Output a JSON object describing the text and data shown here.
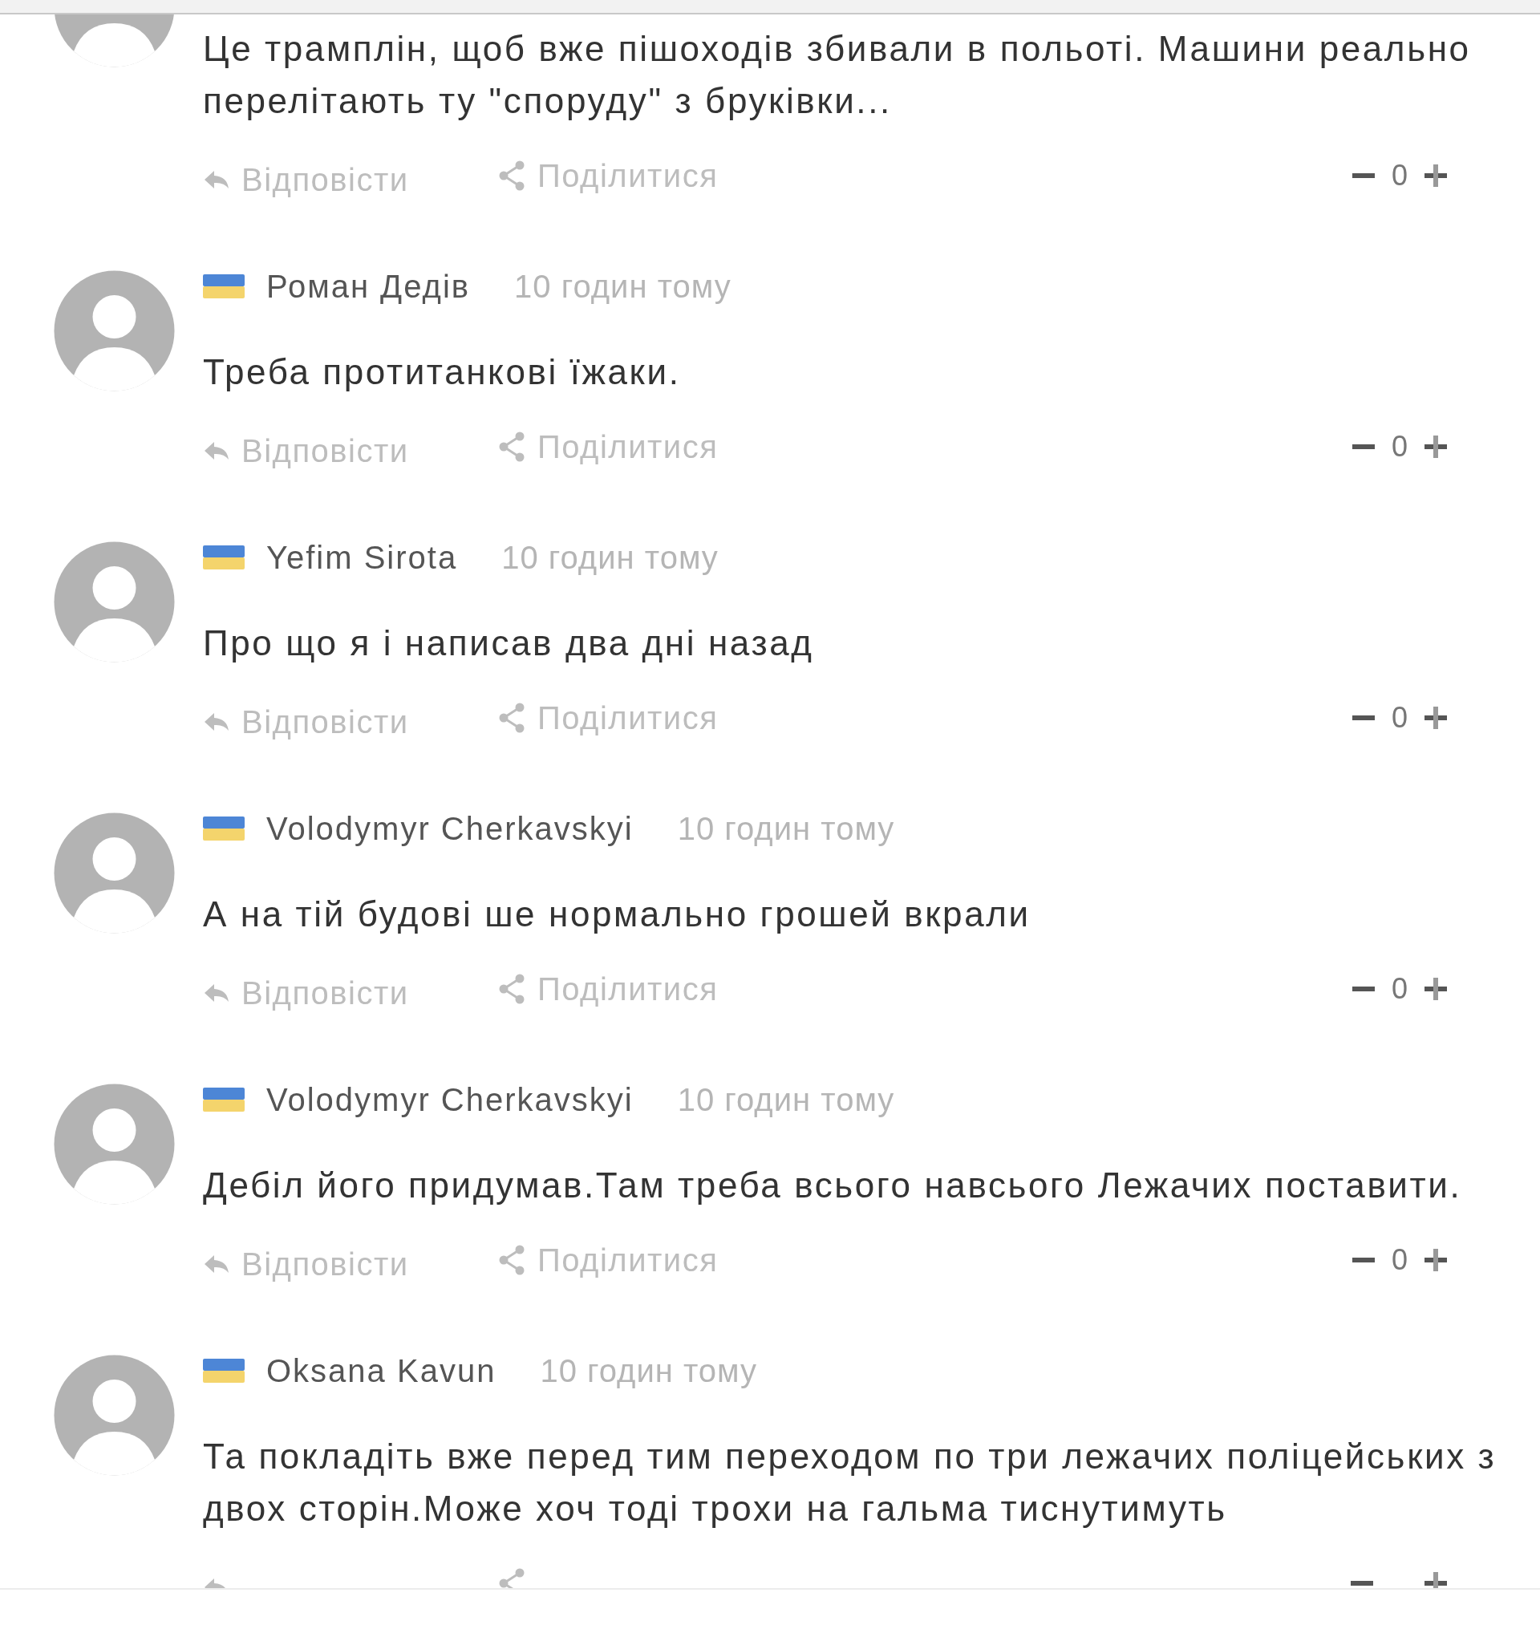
{
  "comments": [
    {
      "body": "Це трамплін, щоб вже пішоходів збивали в польоті. Машини реально перелітають ту \"споруду\" з бруківки...",
      "reply": "Відповісти",
      "share": "Поділитися",
      "score": "0"
    },
    {
      "author": "Роман Дедів",
      "time": "10 годин тому",
      "body": "Треба протитанкові їжаки.",
      "reply": "Відповісти",
      "share": "Поділитися",
      "score": "0"
    },
    {
      "author": "Yefim Sirota",
      "time": "10 годин тому",
      "body": "Про що я і написав два дні назад",
      "reply": "Відповісти",
      "share": "Поділитися",
      "score": "0"
    },
    {
      "author": "Volodymyr Cherkavskyi",
      "time": "10 годин тому",
      "body": "А на тій будові ше нормально грошей вкрали",
      "reply": "Відповісти",
      "share": "Поділитися",
      "score": "0"
    },
    {
      "author": "Volodymyr Cherkavskyi",
      "time": "10 годин тому",
      "body": "Дебіл його придумав.Там треба всього навсього Лежачих поставити.",
      "reply": "Відповісти",
      "share": "Поділитися",
      "score": "0"
    },
    {
      "author": "Oksana Kavun",
      "time": "10 годин тому",
      "body": "Та покладіть вже перед тим переходом по три лежачих поліцейських з двох сторін.Може хоч тоді трохи на гальма тиснутимуть"
    }
  ]
}
